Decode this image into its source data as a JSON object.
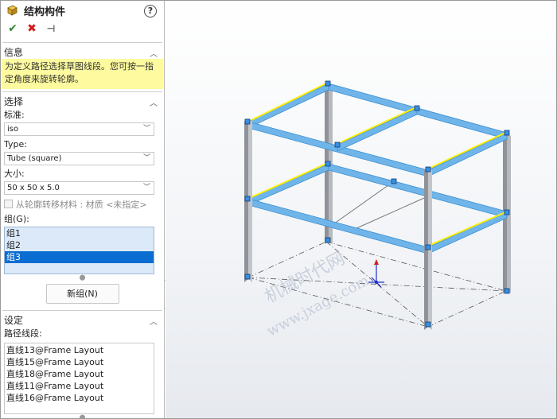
{
  "panel": {
    "title": "结构构件",
    "help": "?",
    "actions": {
      "ok": "✔",
      "cancel": "✖",
      "pin": "⊣"
    },
    "info": {
      "header": "信息",
      "text": "为定义路径选择草图线段。您可按一指定角度来旋转轮廓。"
    },
    "selection": {
      "header": "选择",
      "standard_label": "标准:",
      "standard_value": "iso",
      "type_label": "Type:",
      "type_value": "Tube (square)",
      "size_label": "大小:",
      "size_value": "50 x 50 x 5.0",
      "transfer_material_label": "从轮廓转移材料 : 材质 <未指定>",
      "groups_label": "组(G):",
      "groups": [
        "组1",
        "组2",
        "组3"
      ],
      "selected_group": "组3",
      "new_group_button": "新组(N)"
    },
    "settings": {
      "header": "设定",
      "path_segments_label": "路径线段:",
      "path_segments": [
        "直线13@Frame Layout",
        "直线15@Frame Layout",
        "直线18@Frame Layout",
        "直线11@Frame Layout",
        "直线16@Frame Layout"
      ]
    }
  },
  "viewport": {
    "watermark_cn": "机械时代网",
    "watermark_url": "www.jxage.com"
  },
  "colors": {
    "member": "#a8acb2",
    "selected_member": "#5aa9e6",
    "highlight": "#ffef00",
    "info_background": "#fdfa9f",
    "selection_blue": "#0b6dd1"
  }
}
